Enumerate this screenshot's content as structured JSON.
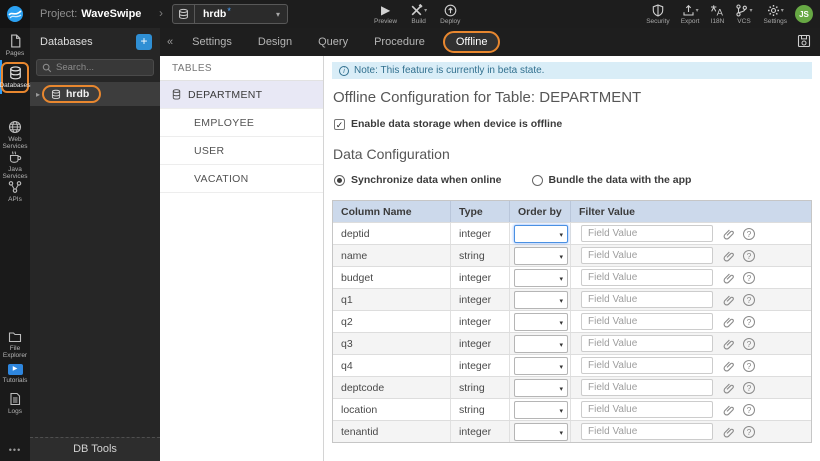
{
  "topbar": {
    "project_label": "Project:",
    "project_name": "WaveSwipe",
    "db_selector": {
      "value": "hrdb",
      "modified_marker": "*"
    },
    "actions": {
      "preview": "Preview",
      "build": "Build",
      "deploy": "Deploy"
    },
    "tools": {
      "security": "Security",
      "export": "Export",
      "i18n": "I18N",
      "vcs": "VCS",
      "settings": "Settings"
    },
    "avatar_initials": "JS"
  },
  "sidebar": {
    "items": [
      {
        "label": "Pages",
        "active": false
      },
      {
        "label": "Databases",
        "active": true
      },
      {
        "label": "Web Services",
        "active": false
      },
      {
        "label": "Java Services",
        "active": false
      },
      {
        "label": "APIs",
        "active": false
      },
      {
        "label": "File Explorer",
        "active": false
      },
      {
        "label": "Tutorials",
        "active": false
      },
      {
        "label": "Logs",
        "active": false
      }
    ],
    "more": "•••"
  },
  "db_panel": {
    "title": "Databases",
    "add_label": "+",
    "search_placeholder": "Search...",
    "database_name": "hrdb",
    "footer": "DB Tools"
  },
  "tabs": {
    "items": [
      "Settings",
      "Design",
      "Query",
      "Procedure",
      "Offline"
    ],
    "active": "Offline"
  },
  "tables_panel": {
    "header": "TABLES",
    "items": [
      "DEPARTMENT",
      "EMPLOYEE",
      "USER",
      "VACATION"
    ],
    "selected": "DEPARTMENT"
  },
  "offline": {
    "note": "Note: This feature is currently in beta state.",
    "title": "Offline Configuration for Table: DEPARTMENT",
    "enable_checkbox": {
      "label": "Enable data storage when device is offline",
      "checked": true
    },
    "section_title": "Data Configuration",
    "radios": [
      {
        "label": "Synchronize data when online",
        "selected": true
      },
      {
        "label": "Bundle the data with the app",
        "selected": false
      }
    ],
    "table": {
      "headers": [
        "Column Name",
        "Type",
        "Order by",
        "Filter Value"
      ],
      "filter_placeholder": "Field Value",
      "rows": [
        {
          "column": "deptid",
          "type": "integer"
        },
        {
          "column": "name",
          "type": "string"
        },
        {
          "column": "budget",
          "type": "integer"
        },
        {
          "column": "q1",
          "type": "integer"
        },
        {
          "column": "q2",
          "type": "integer"
        },
        {
          "column": "q3",
          "type": "integer"
        },
        {
          "column": "q4",
          "type": "integer"
        },
        {
          "column": "deptcode",
          "type": "string"
        },
        {
          "column": "location",
          "type": "string"
        },
        {
          "column": "tenantid",
          "type": "integer"
        }
      ]
    }
  },
  "icons": {
    "caret_down": "▾",
    "chevron_right": "›",
    "collapse": "«",
    "expander": "▸",
    "play": "▶",
    "check": "✓",
    "info": "i",
    "question": "?",
    "more": "•••"
  },
  "colors": {
    "annotation_orange": "#e8872f",
    "accent_blue": "#2f8fd4",
    "note_bg": "#d9edf7",
    "note_text": "#31708f",
    "table_header_bg": "#ccd9eb",
    "avatar_green": "#67a844",
    "selected_row_bg": "#e8e8f5"
  }
}
